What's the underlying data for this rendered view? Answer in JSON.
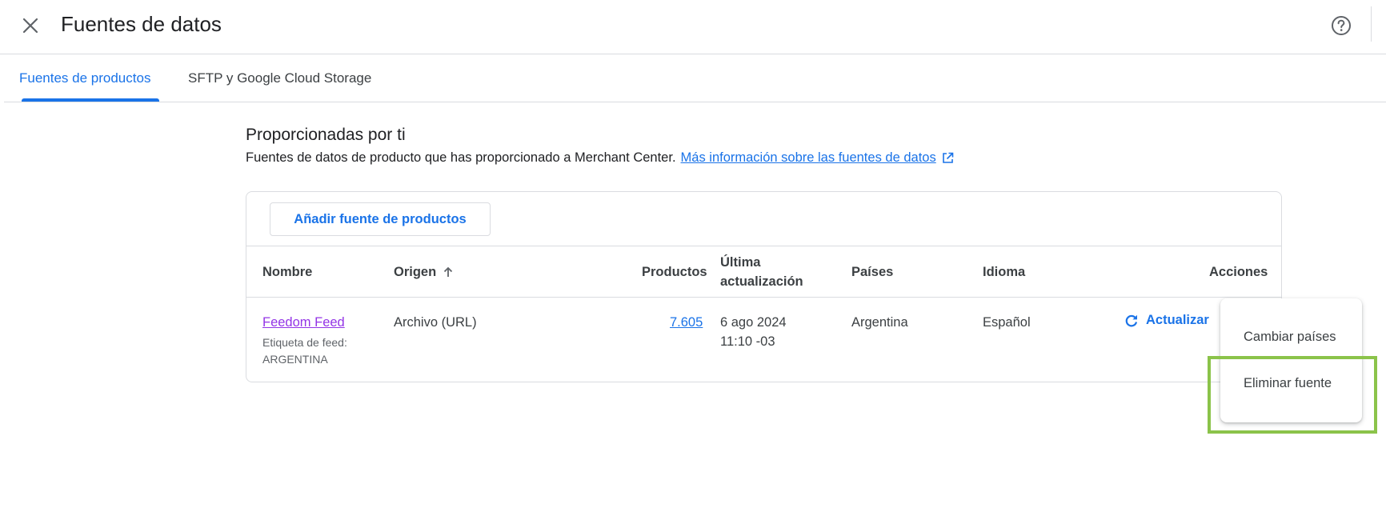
{
  "header": {
    "title": "Fuentes de datos",
    "close_icon": "close-icon",
    "help_icon": "help-circle-icon"
  },
  "tabs": [
    {
      "label": "Fuentes de productos",
      "active": true
    },
    {
      "label": "SFTP y Google Cloud Storage",
      "active": false
    }
  ],
  "section": {
    "title": "Proporcionadas por ti",
    "description": "Fuentes de datos de producto que has proporcionado a Merchant Center.",
    "link_text": "Más información sobre las fuentes de datos",
    "link_icon": "open-in-new-icon"
  },
  "table": {
    "add_button": "Añadir fuente de productos",
    "headers": {
      "nombre": "Nombre",
      "origen": "Origen",
      "productos": "Productos",
      "ultima_line1": "Última",
      "ultima_line2": "actualización",
      "paises": "Países",
      "idioma": "Idioma",
      "acciones": "Acciones"
    },
    "sort_icon": "arrow-up-icon",
    "rows": [
      {
        "name": "Feedom Feed",
        "label_line1": "Etiqueta de feed:",
        "label_line2": "ARGENTINA",
        "origin": "Archivo (URL)",
        "products": "7.605",
        "updated_line1": "6 ago 2024",
        "updated_line2": "11:10 -03",
        "countries": "Argentina",
        "language": "Español",
        "action": "Actualizar",
        "action_icon": "refresh-icon"
      }
    ]
  },
  "menu": {
    "items": [
      {
        "label": "Cambiar países"
      },
      {
        "label": "Eliminar fuente"
      }
    ]
  },
  "colors": {
    "accent": "#1a73e8",
    "visited_link": "#9334e6",
    "highlight": "#8bc34a"
  }
}
